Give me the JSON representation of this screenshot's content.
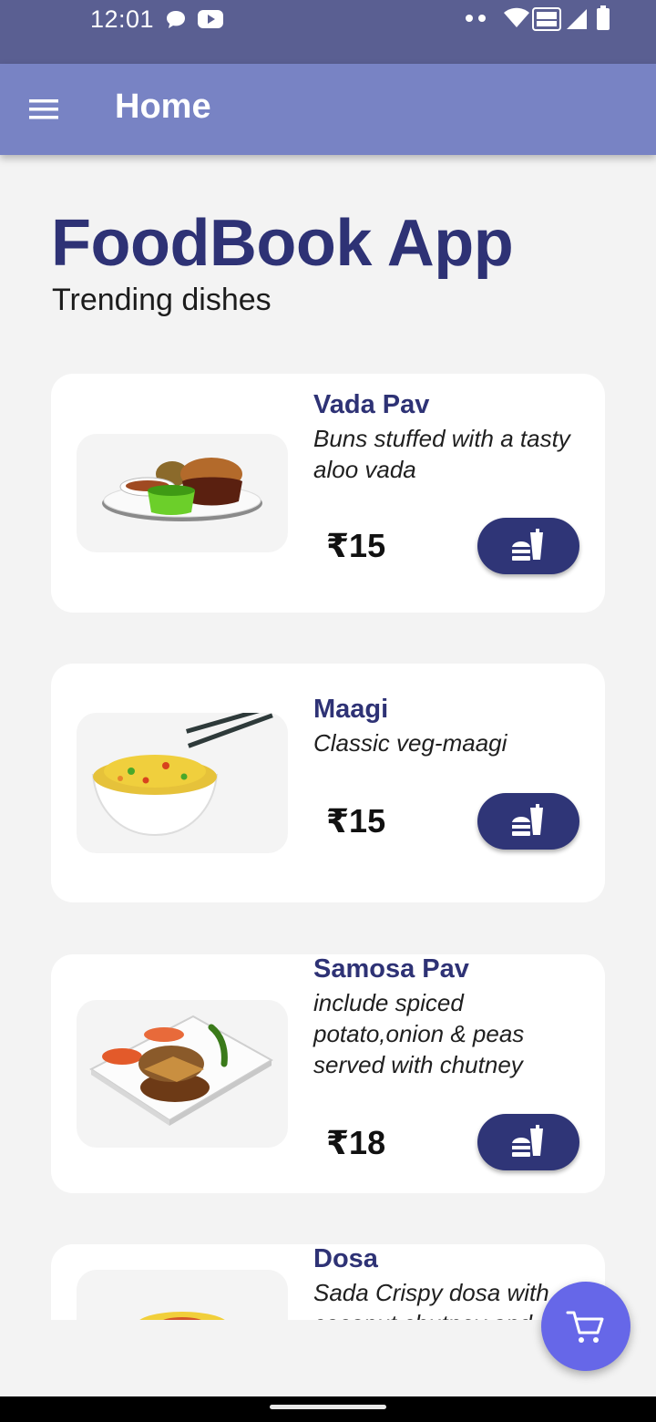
{
  "status_bar": {
    "time": "12:01"
  },
  "app_bar": {
    "title": "Home",
    "menu_icon": "hamburger-menu-icon"
  },
  "page": {
    "heading": "FoodBook App",
    "subheading": "Trending dishes"
  },
  "dishes": [
    {
      "name": "Vada Pav",
      "description": "Buns stuffed with a tasty aloo vada",
      "price": "₹15",
      "image": "vada-pav-image"
    },
    {
      "name": "Maagi",
      "description": "Classic veg-maagi",
      "price": "₹15",
      "image": "maagi-image"
    },
    {
      "name": "Samosa Pav",
      "description": "include spiced potato,onion & peas served with chutney",
      "price": "₹18",
      "image": "samosa-pav-image"
    },
    {
      "name": "Dosa",
      "description": "Sada Crispy dosa with coconut chutney and",
      "price": "",
      "image": "dosa-image"
    }
  ],
  "cart_fab": {
    "icon": "cart-icon"
  },
  "colors": {
    "status_bar": "#5a5f92",
    "app_bar": "#7883c4",
    "heading": "#2e3275",
    "button": "#2f3577",
    "fab": "#6667e8",
    "background": "#f3f3f3"
  }
}
